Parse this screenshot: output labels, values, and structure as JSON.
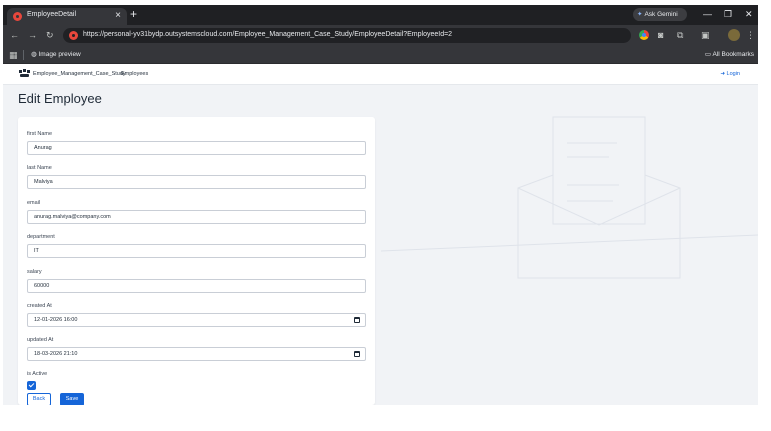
{
  "browser": {
    "tab_title": "EmployeeDetail",
    "tab_close": "×",
    "new_tab": "+",
    "ask_gemini": "Ask Gemini",
    "url": "https://personal-yv31bydp.outsystemscloud.com/Employee_Management_Case_Study/EmployeeDetail?EmployeeId=2",
    "bookmark_item": "Image preview",
    "all_bookmarks": "All Bookmarks"
  },
  "header": {
    "app_name": "Employee_Management_Case_Study",
    "nav_item": "Employees",
    "login": "Login"
  },
  "page": {
    "title": "Edit Employee"
  },
  "form": {
    "first_name": {
      "label": "first Name",
      "value": "Anurag"
    },
    "last_name": {
      "label": "last Name",
      "value": "Malviya"
    },
    "email": {
      "label": "email",
      "value": "anurag.malviya@company.com"
    },
    "department": {
      "label": "department",
      "value": "IT"
    },
    "salary": {
      "label": "salary",
      "value": "60000"
    },
    "created_at": {
      "label": "created At",
      "value": "12-01-2026 16:00"
    },
    "updated_at": {
      "label": "updated At",
      "value": "18-03-2026 21:10"
    },
    "is_active": {
      "label": "is Active",
      "checked": true
    },
    "back_label": "Back",
    "save_label": "Save"
  },
  "colors": {
    "primary": "#1565d8",
    "page_bg": "#f1f3f6",
    "browser_dark": "#35363a"
  }
}
